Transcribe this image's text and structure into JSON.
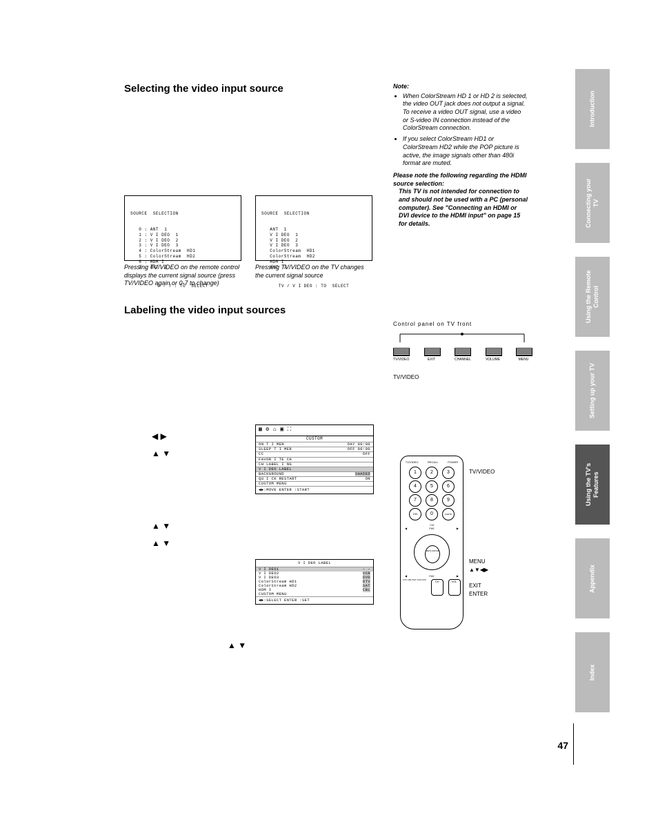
{
  "h1": "Selecting the video input source",
  "h2": "Labeling the video input sources",
  "osd1": {
    "title": "SOURCE  SELECTION",
    "lines": "   0 : ANT  1\n   1 : V I DEO  1\n   2 : V I DEO  2\n   3 : V I DEO  3\n   4 : ColorStream  HD1\n   5 : ColorStream  HD2\n   6 : HDM I\n   7 : ANT  2",
    "foot": "0 – 7 : TO  SELECT"
  },
  "osd2": {
    "title": "SOURCE  SELECTION",
    "lines": "   ANT  1\n   V I DEO  1\n   V I DEO  2\n   V I DEO  3\n   ColorStream  HD1\n   ColorStream  HD2\n   HDM I\n   ANT  2",
    "foot": "TV / V I DEO : TO  SELECT"
  },
  "cap1": "Pressing TV/VIDEO on the remote control displays the current signal source (press TV/VIDEO again or 0-7 to change)",
  "cap2": "Pressing TV/VIDEO on the TV changes the current signal source",
  "notes": {
    "label": "Note:",
    "li1": "When ColorStream HD 1 or HD 2 is selected, the video OUT jack does not output a signal. To receive a video OUT signal, use a video or S-video IN connection instead of the ColorStream connection.",
    "li2": "If you select ColorStream HD1 or ColorStream HD2 while the POP picture is active, the image signals other than 480i format are muted.",
    "bold": "Please note the following regarding the HDMI source selection:",
    "inner": "This TV is not intended for connection to and should not be used with a PC (personal computer). See \"Connecting an HDMI or DVI device to the HDMI input\" on page 15 for details."
  },
  "front": {
    "hdr": "Control panel on TV front",
    "b1": "TV/VIDEO",
    "b2": "EXIT",
    "b3": "CHANNEL",
    "b4": "VOLUME",
    "b5": "MENU",
    "tvv": "TV/VIDEO"
  },
  "custom": {
    "title": "CUSTOM",
    "r1a": "ON  T I MER",
    "r1b": "DAY  00:00",
    "r2a": "SLEEP  T I MER",
    "r2b": "OFF  00:00",
    "r3a": "CC",
    "r3b": "OFF",
    "r4a": "FAVOR I TE  CH",
    "r5a": "CH  LABEL I NG",
    "r6a": "V I DEO  LABEL",
    "r7a": "BACKGROUND",
    "r7b": "SHADED",
    "r8a": "QU I CK  RESTART",
    "r8b": "ON",
    "r9a": "CUSTOM MENU",
    "foot": "◀▶:MOVE   ENTER :START"
  },
  "vlabel": {
    "title": "V I DEO  LABEL",
    "rows": [
      {
        "a": "V I DEO1",
        "b": "– –"
      },
      {
        "a": "V I DEO2",
        "b": "VCR"
      },
      {
        "a": "V I DEO3",
        "b": "DVD"
      },
      {
        "a": "ColorStream  HD1",
        "b": "DTV"
      },
      {
        "a": "ColorStream  HD2",
        "b": "SAT"
      },
      {
        "a": "HDM I",
        "b": "CBL"
      },
      {
        "a": "CUSTOM MENU",
        "b": ""
      }
    ],
    "foot": "◀▶:SELECT   ENTER :SET"
  },
  "remote_labels": {
    "l1": "TV/VIDEO",
    "l2": "MENU",
    "l3": "▲▼◀▶",
    "l4": "EXIT",
    "l5": "ENTER"
  },
  "remote": {
    "t1": "TV/VIDEO",
    "t2": "RECALL",
    "t3": "POWER",
    "n100": "100",
    "nchrtn": "CHRTN",
    "nplus": "+10",
    "center": "MENU ENTER",
    "ch": "CH",
    "vol": "VOL",
    "fav": "FAV",
    "dtv": "DTV CBL/SAT VCR DVD"
  },
  "arrows": {
    "a1": "◀    ▶",
    "a2": "▲    ▼",
    "a3": "▲    ▼",
    "a4": "▲    ▼",
    "a5": "▲    ▼"
  },
  "tabs": {
    "t1": "Introduction",
    "t2": "Connecting your TV",
    "t3": "Using the Remote Control",
    "t4": "Setting up your TV",
    "t5": "Using the TV's Features",
    "t6": "Appendix",
    "t7": "Index"
  },
  "page": "47"
}
